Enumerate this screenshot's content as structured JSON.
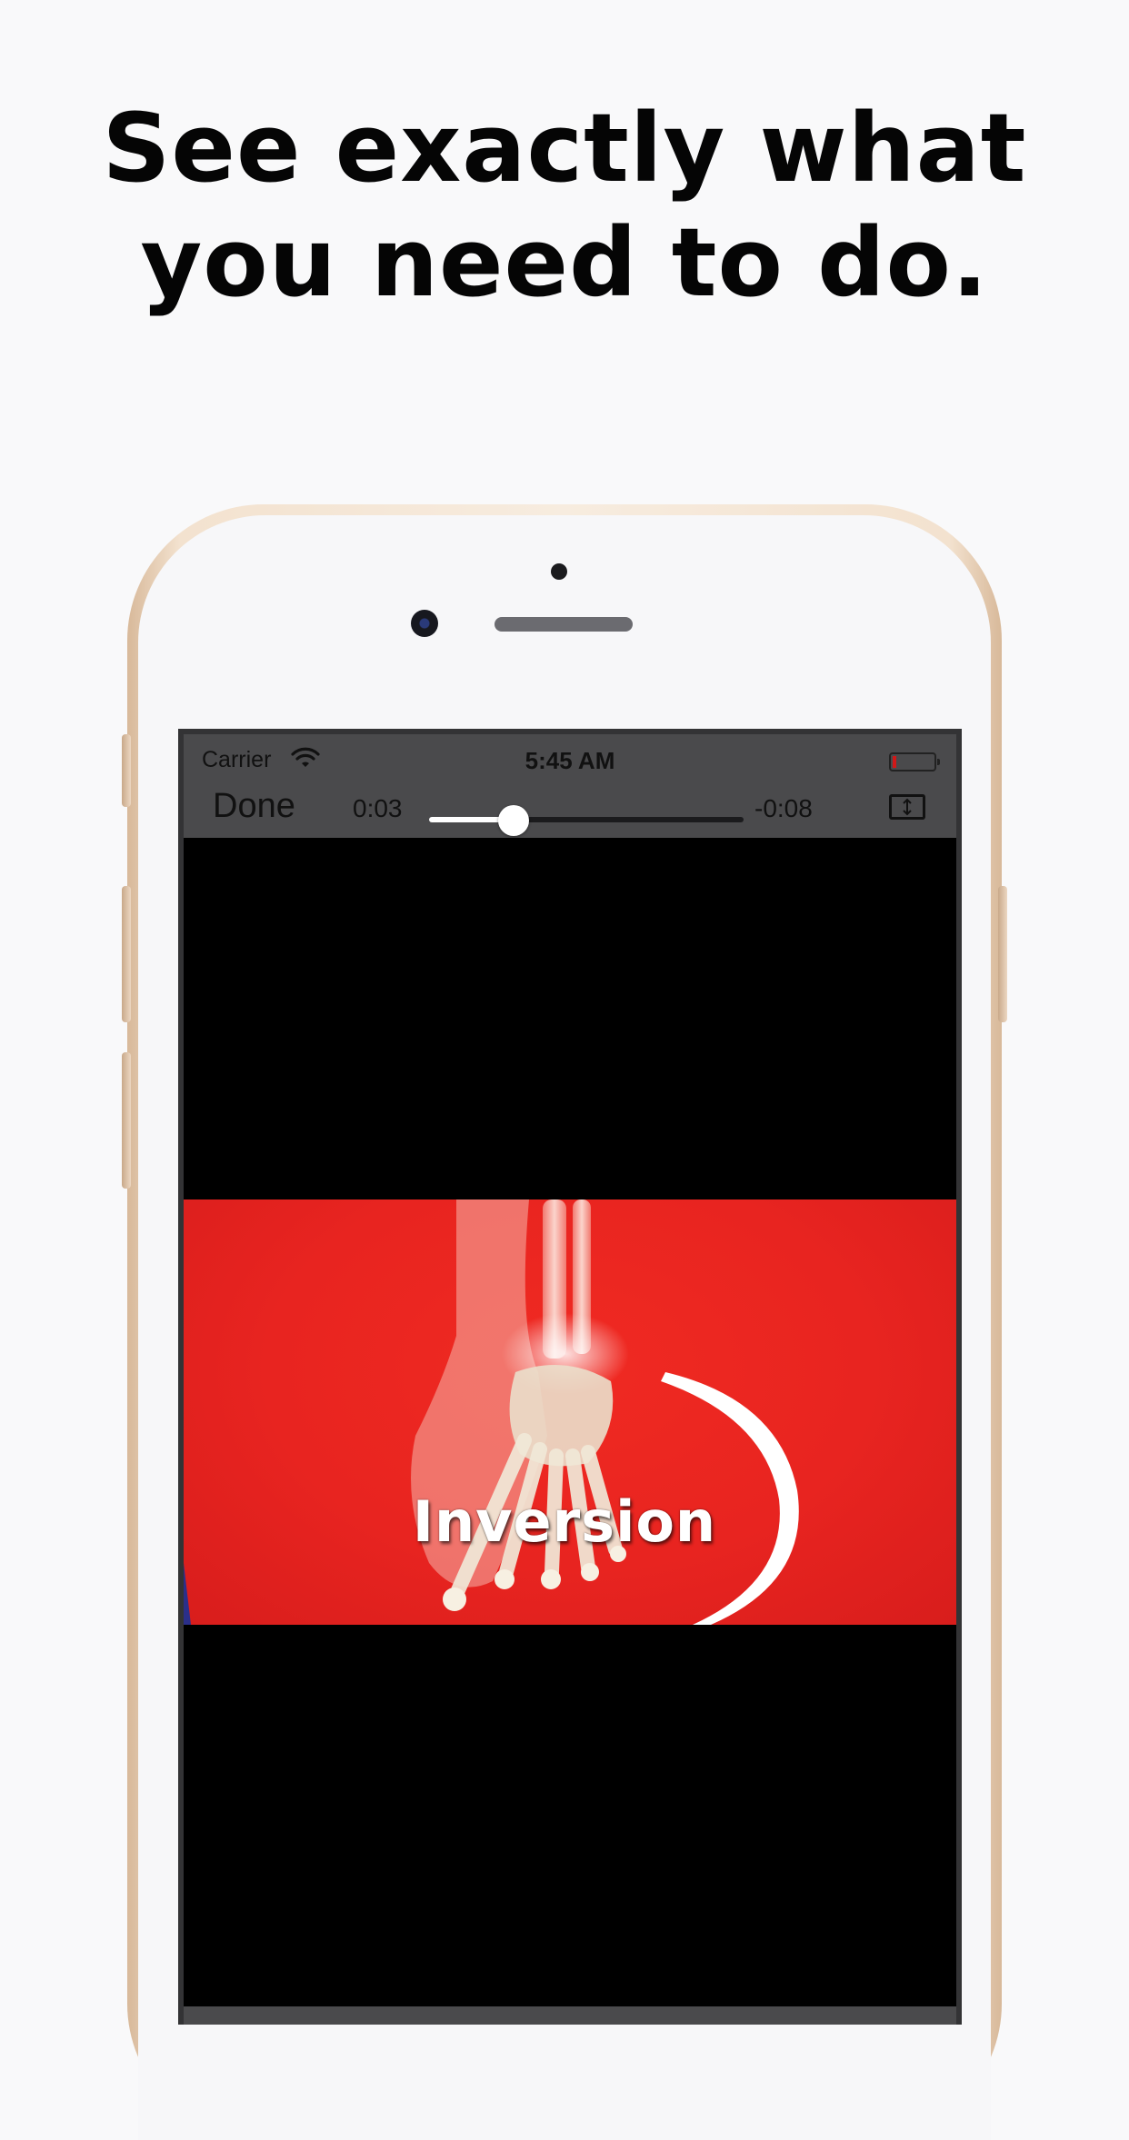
{
  "headline": {
    "line1": "See exactly what",
    "line2": "you need to do."
  },
  "status_bar": {
    "carrier": "Carrier",
    "time": "5:45 AM",
    "wifi_icon": "wifi-icon",
    "battery_icon": "battery-icon",
    "battery_level_fraction": 0.1,
    "battery_color": "#d01818"
  },
  "player": {
    "done_label": "Done",
    "elapsed": "0:03",
    "remaining": "-0:08",
    "progress_fraction": 0.27,
    "aspect_icon": "aspect-toggle-icon"
  },
  "video": {
    "caption": "Inversion",
    "background_color": "#e82420"
  },
  "colors": {
    "page_background": "#f9f9fa",
    "phone_frame": "#f3e2cf",
    "player_chrome": "#4a4a4c"
  }
}
